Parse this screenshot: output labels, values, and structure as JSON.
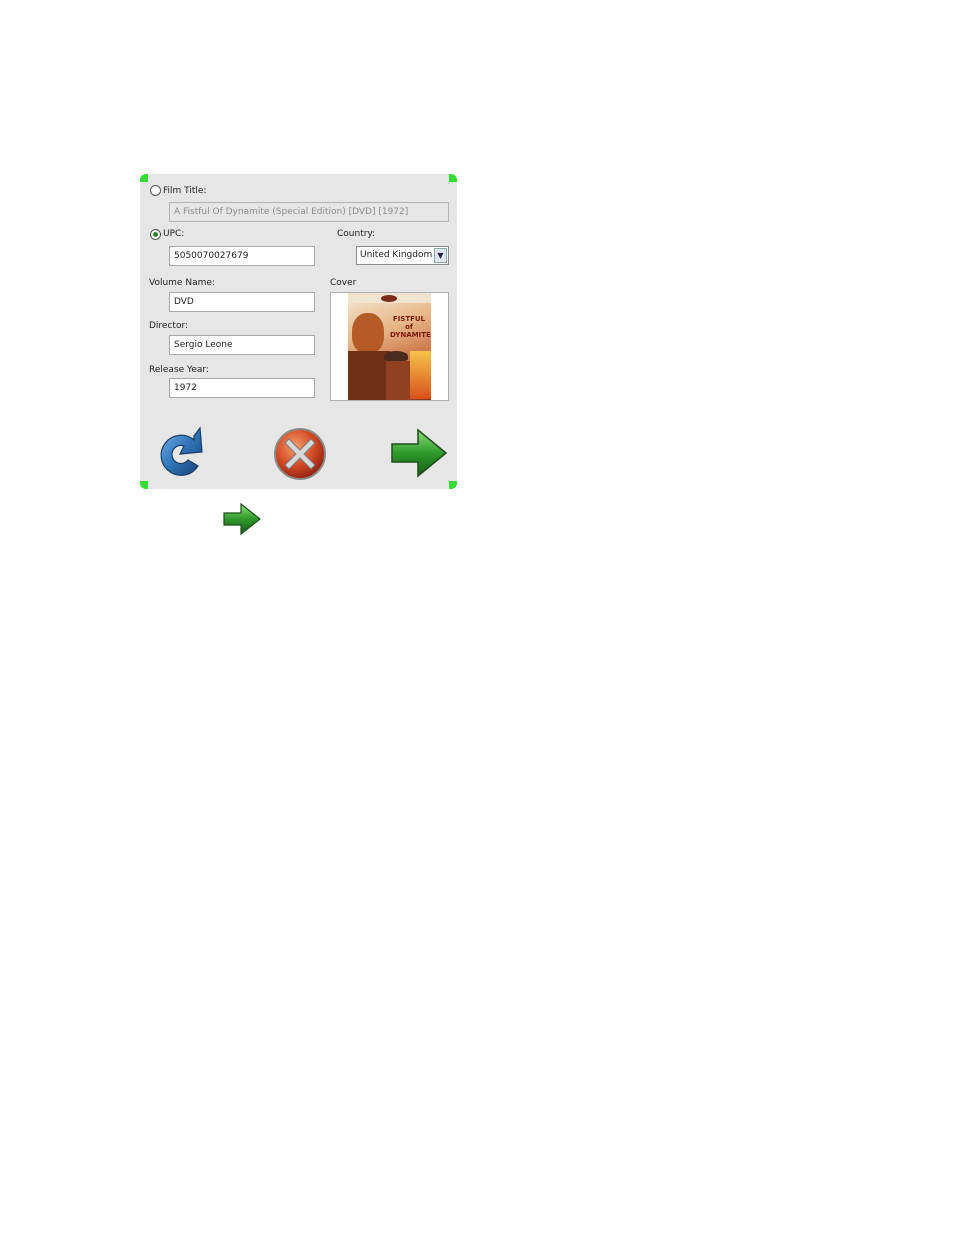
{
  "dialog": {
    "film_title": {
      "label": "Film Title:",
      "value": "A Fistful Of Dynamite (Special Edition) [DVD] [1972]",
      "selected": false
    },
    "upc": {
      "label": "UPC:",
      "value": "5050070027679",
      "selected": true
    },
    "country": {
      "label": "Country:",
      "value": "United Kingdom"
    },
    "volume_name": {
      "label": "Volume Name:",
      "value": "DVD"
    },
    "director": {
      "label": "Director:",
      "value": "Sergio Leone"
    },
    "release_year": {
      "label": "Release Year:",
      "value": "1972"
    },
    "cover": {
      "label": "Cover",
      "poster_title": "FISTFUL of DYNAMITE"
    },
    "buttons": {
      "refresh_icon": "refresh-icon",
      "cancel_icon": "cancel-icon",
      "next_icon": "next-arrow-icon"
    },
    "colors": {
      "accent": "#33dd33",
      "background": "#e6e6e6"
    }
  }
}
